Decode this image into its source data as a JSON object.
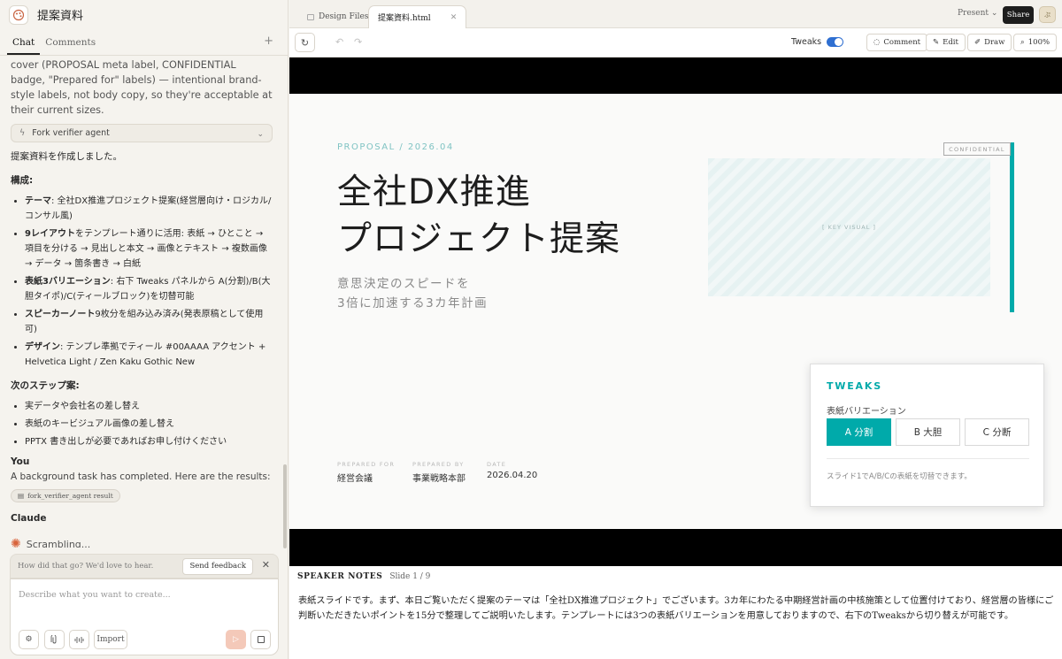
{
  "project": {
    "title": "提案資料"
  },
  "left_tabs": [
    "Chat",
    "Comments"
  ],
  "chat": {
    "intro": "cover (PROPOSAL meta label, CONFIDENTIAL badge, \"Prepared for\" labels) — intentional brand-style labels, not body copy, so they're acceptable at their current sizes.",
    "agent_label": "Fork verifier agent",
    "done": "提案資料を作成しました。",
    "structure_heading": "構成:",
    "items": [
      {
        "bold": "テーマ",
        "text": ": 全社DX推進プロジェクト提案(経営層向け・ロジカル/コンサル風)"
      },
      {
        "bold": "9レイアウト",
        "text": "をテンプレート通りに活用: 表紙 → ひとこと → 項目を分ける → 見出しと本文 → 画像とテキスト → 複数画像 → データ → 箇条書き → 白紙"
      },
      {
        "bold": "表紙3バリエーション",
        "text": ": 右下 Tweaks パネルから A(分割)/B(大胆タイポ)/C(ティールブロック)を切替可能"
      },
      {
        "bold": "スピーカーノート",
        "text": "9枚分を組み込み済み(発表原稿として使用可)"
      },
      {
        "bold": "デザイン",
        "text": ": テンプレ準拠でティール #00AAAA アクセント + Helvetica Light / Zen Kaku Gothic New"
      }
    ],
    "next_heading": "次のステップ案:",
    "next_items": [
      "実データや会社名の差し替え",
      "表紙のキービジュアル画像の差し替え",
      "PPTX 書き出しが必要であればお申し付けください"
    ],
    "you_label": "You",
    "you_text": "A background task has completed. Here are the results:",
    "chip": "fork_verifier_agent result",
    "claude_label": "Claude",
    "status": "Scrambling..."
  },
  "feedback": {
    "prompt": "How did that go? We'd love to hear.",
    "button": "Send feedback"
  },
  "composer": {
    "placeholder": "Describe what you want to create...",
    "import_label": "Import"
  },
  "file_tabs": [
    "Design Files",
    "提案資料.html"
  ],
  "topbar": {
    "present": "Present",
    "share": "Share",
    "avatar": "ぷ"
  },
  "toolbar": {
    "tweaks": "Tweaks",
    "comment": "Comment",
    "edit": "Edit",
    "draw": "Draw",
    "zoom": "100%"
  },
  "slide": {
    "meta": "PROPOSAL / 2026.04",
    "title_lines": [
      "全社DX推進",
      "プロジェクト提案"
    ],
    "subtitle_lines": [
      "意思決定のスピードを",
      "3倍に加速する3カ年計画"
    ],
    "key_visual": "[ KEY VISUAL ]",
    "confidential": "CONFIDENTIAL",
    "prepared": [
      {
        "label": "PREPARED FOR",
        "value": "経営会議"
      },
      {
        "label": "PREPARED BY",
        "value": "事業戦略本部"
      },
      {
        "label": "DATE",
        "value": "2026.04.20"
      }
    ],
    "accent_color": "#00AAAA"
  },
  "tweaks_panel": {
    "title": "TWEAKS",
    "label": "表紙バリエーション",
    "options": [
      "A 分割",
      "B 大胆",
      "C 分断"
    ],
    "selected": "A 分割",
    "note": "スライド1でA/B/Cの表紙を切替できます。"
  },
  "notes": {
    "heading": "SPEAKER NOTES",
    "slide": "Slide 1 / 9",
    "text": "表紙スライドです。まず、本日ご覧いただく提案のテーマは「全社DX推進プロジェクト」でございます。3カ年にわたる中期経営計画の中核施策として位置付けており、経営層の皆様にご判断いただきたいポイントを15分で整理してご説明いたします。テンプレートには3つの表紙バリエーションを用意しておりますので、右下のTweaksから切り替えが可能です。"
  }
}
